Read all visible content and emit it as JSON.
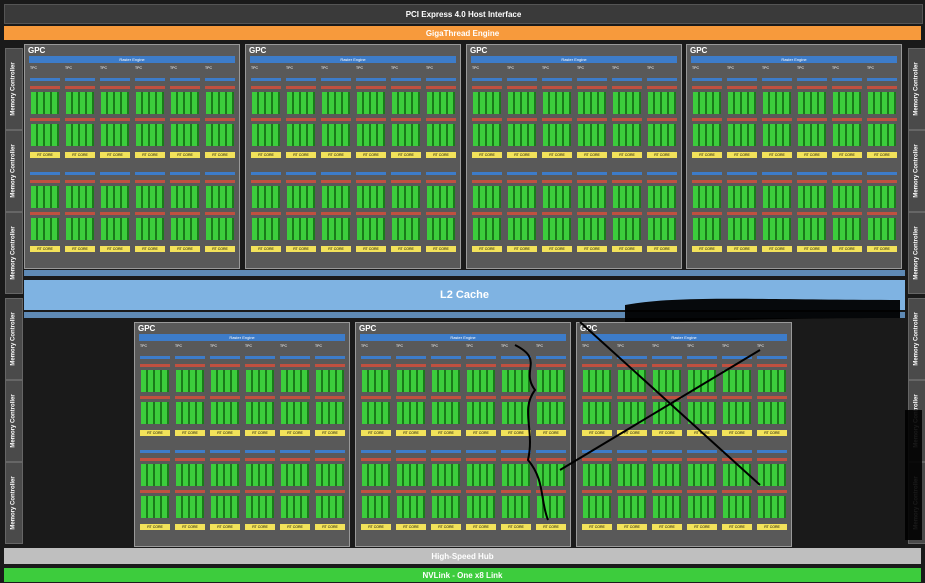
{
  "top_bar": {
    "label": "PCI Express 4.0 Host Interface"
  },
  "giga_bar": {
    "label": "GigaThread Engine"
  },
  "l2": {
    "label": "L2 Cache"
  },
  "hub": {
    "label": "High-Speed Hub"
  },
  "nvlink": {
    "label": "NVLink - One x8 Link"
  },
  "memory_controller_label": "Memory Controller",
  "gpc_label": "GPC",
  "raster_label": "Raster Engine",
  "tpc_label": "TPC",
  "rt_core_label": "RT CORE",
  "colors": {
    "accent_blue": "#3d7cc9",
    "l2": "#7fb3e2",
    "giga": "#f79a3c",
    "nvlink": "#3dcc3d",
    "sm_green": "#2e9b2e",
    "rt_yellow": "#f2e25a"
  }
}
